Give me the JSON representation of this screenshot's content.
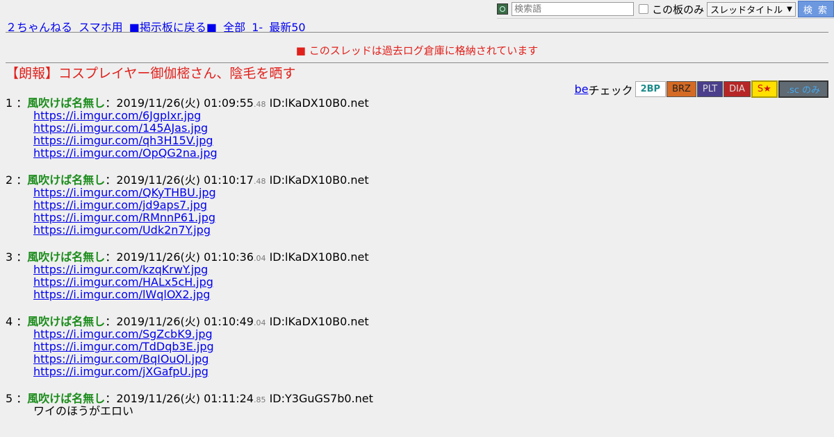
{
  "search": {
    "placeholder": "検索語",
    "board_only_label": "この板のみ",
    "select_value": "スレッドタイトル",
    "button_label": "検 索"
  },
  "nav": {
    "items": [
      "２ちゃんねる",
      "スマホ用",
      "■掲示板に戻る■",
      "全部",
      "1-",
      "最新50"
    ]
  },
  "archive_notice": "■ このスレッドは過去ログ倉庫に格納されています",
  "thread_title": "【朗報】コスプレイヤー御伽樒さん、陰毛を晒す",
  "becheck": {
    "be_link": "be",
    "be_text": "チェック",
    "badges": [
      "2BP",
      "BRZ",
      "PLT",
      "DIA",
      "S★",
      ".sc のみ"
    ]
  },
  "posts": [
    {
      "num": "1",
      "name": "風吹けば名無し",
      "date": "2019/11/26(火) 01:09:55",
      "ms": ".48",
      "id": "ID:lKaDX10B0.net",
      "lines": [
        "https://i.imgur.com/6JgpIxr.jpg",
        "https://i.imgur.com/145AJas.jpg",
        "https://i.imgur.com/qh3H15V.jpg",
        "https://i.imgur.com/OpQG2na.jpg"
      ]
    },
    {
      "num": "2",
      "name": "風吹けば名無し",
      "date": "2019/11/26(火) 01:10:17",
      "ms": ".48",
      "id": "ID:lKaDX10B0.net",
      "lines": [
        "https://i.imgur.com/QKyTHBU.jpg",
        "https://i.imgur.com/jd9aps7.jpg",
        "https://i.imgur.com/RMnnP61.jpg",
        "https://i.imgur.com/Udk2n7Y.jpg"
      ]
    },
    {
      "num": "3",
      "name": "風吹けば名無し",
      "date": "2019/11/26(火) 01:10:36",
      "ms": ".04",
      "id": "ID:lKaDX10B0.net",
      "lines": [
        "https://i.imgur.com/kzqKrwY.jpg",
        "https://i.imgur.com/HALx5cH.jpg",
        "https://i.imgur.com/lWqlOX2.jpg"
      ]
    },
    {
      "num": "4",
      "name": "風吹けば名無し",
      "date": "2019/11/26(火) 01:10:49",
      "ms": ".04",
      "id": "ID:lKaDX10B0.net",
      "lines": [
        "https://i.imgur.com/SgZcbK9.jpg",
        "https://i.imgur.com/TdDqb3E.jpg",
        "https://i.imgur.com/BqIOuQl.jpg",
        "https://i.imgur.com/jXGafpU.jpg"
      ]
    },
    {
      "num": "5",
      "name": "風吹けば名無し",
      "date": "2019/11/26(火) 01:11:24",
      "ms": ".85",
      "id": "ID:Y3GuGS7b0.net",
      "text": [
        "ワイのほうがエロい"
      ]
    }
  ],
  "colors": {
    "red": "#e0201b",
    "name_green": "#1b8c1b",
    "link_blue": "#0000ee",
    "bg": "#efefef"
  }
}
